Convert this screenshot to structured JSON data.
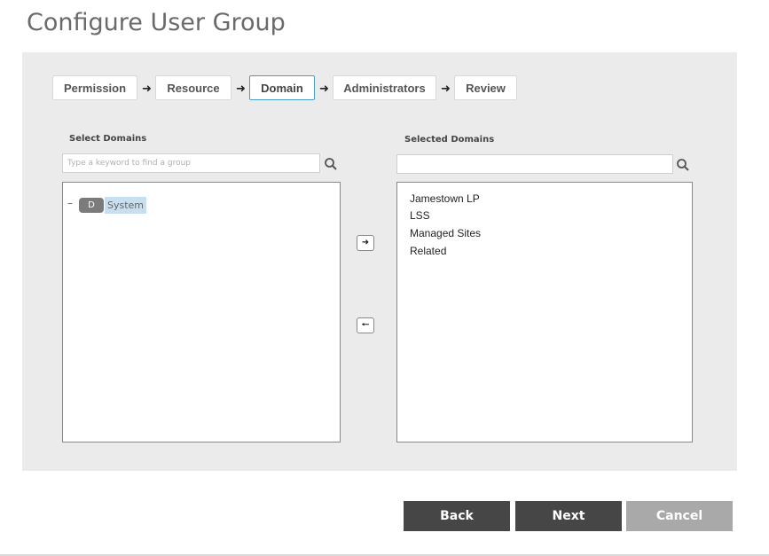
{
  "page": {
    "title": "Configure User Group"
  },
  "wizard": {
    "steps": [
      {
        "label": "Permission"
      },
      {
        "label": "Resource"
      },
      {
        "label": "Domain",
        "active": true
      },
      {
        "label": "Administrators"
      },
      {
        "label": "Review"
      }
    ]
  },
  "available": {
    "label": "Select Domains",
    "search_placeholder": "Type a keyword to find a group",
    "tree": [
      {
        "badge": "D",
        "name": "System",
        "expanded": true,
        "highlighted": true
      }
    ]
  },
  "selected": {
    "label": "Selected Domains",
    "search_value": "",
    "items": [
      "Jamestown LP",
      "LSS",
      "Managed Sites",
      "Related"
    ]
  },
  "buttons": {
    "back": "Back",
    "next": "Next",
    "cancel": "Cancel"
  },
  "colors": {
    "panel_bg": "#ebebeb",
    "active_step_border": "#4a9cc8",
    "highlight": "#c8dff0",
    "button_dark": "#464646",
    "button_disabled": "#a9a9a9"
  }
}
